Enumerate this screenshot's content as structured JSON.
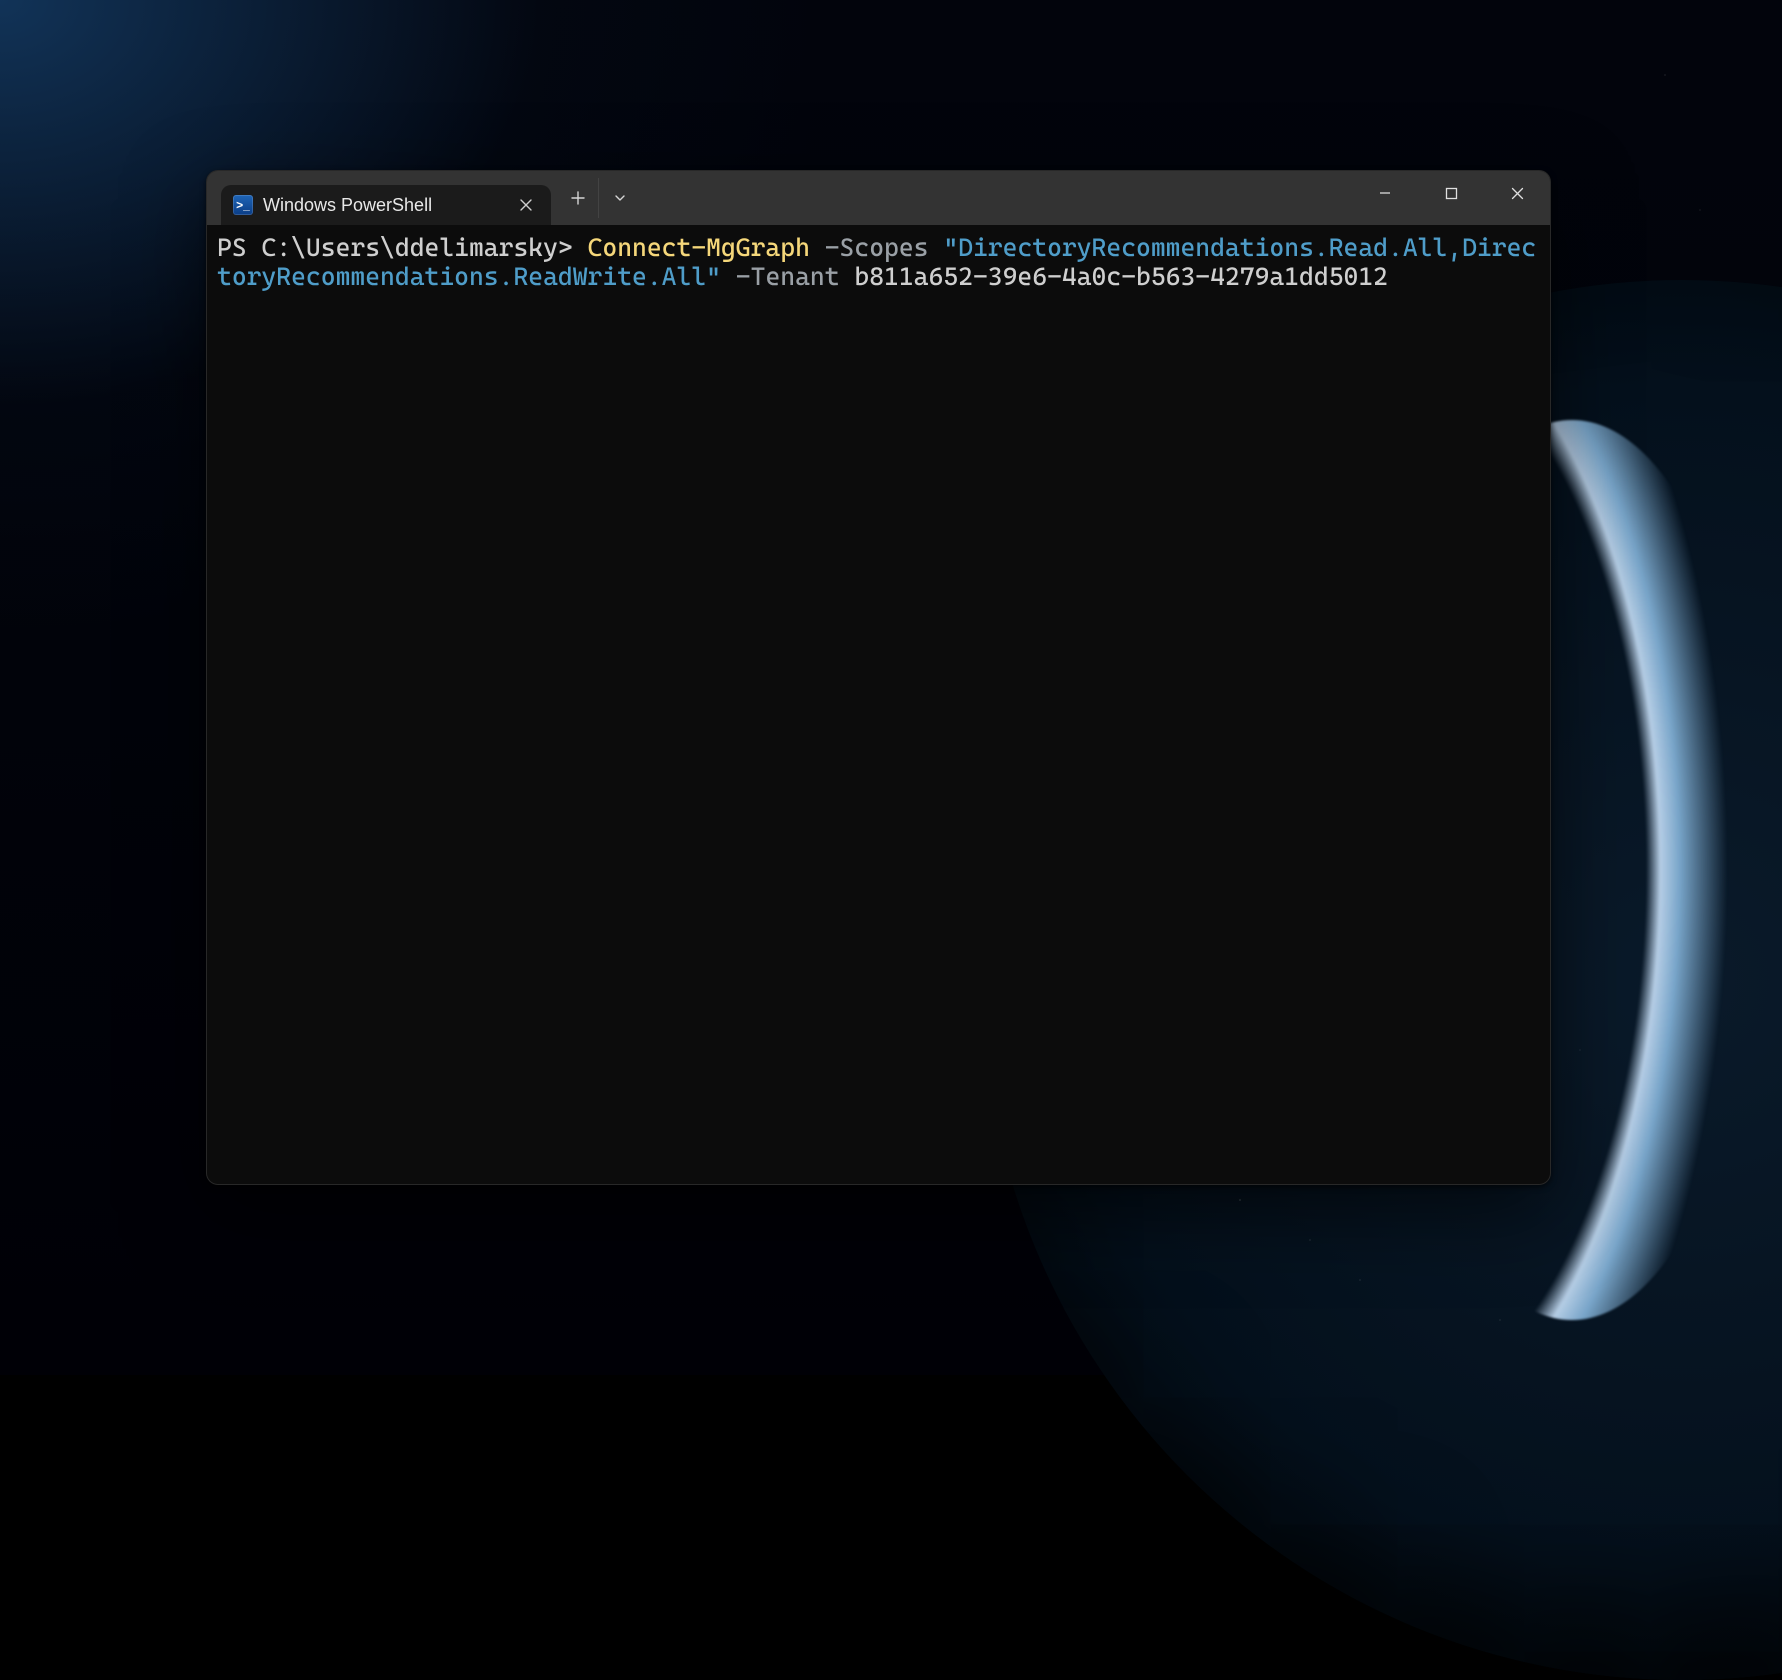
{
  "window": {
    "tab_title": "Windows PowerShell"
  },
  "terminal": {
    "prompt": "PS C:\\Users\\ddelimarsky> ",
    "command": "Connect-MgGraph",
    "param_scopes": "-Scopes",
    "scopes_value": "\"DirectoryRecommendations.Read.All,DirectoryRecommendations.ReadWrite.All\"",
    "param_tenant": "-Tenant",
    "tenant_value": "b811a652-39e6-4a0c-b563-4279a1dd5012"
  },
  "icons": {
    "ps_label": ">_"
  }
}
